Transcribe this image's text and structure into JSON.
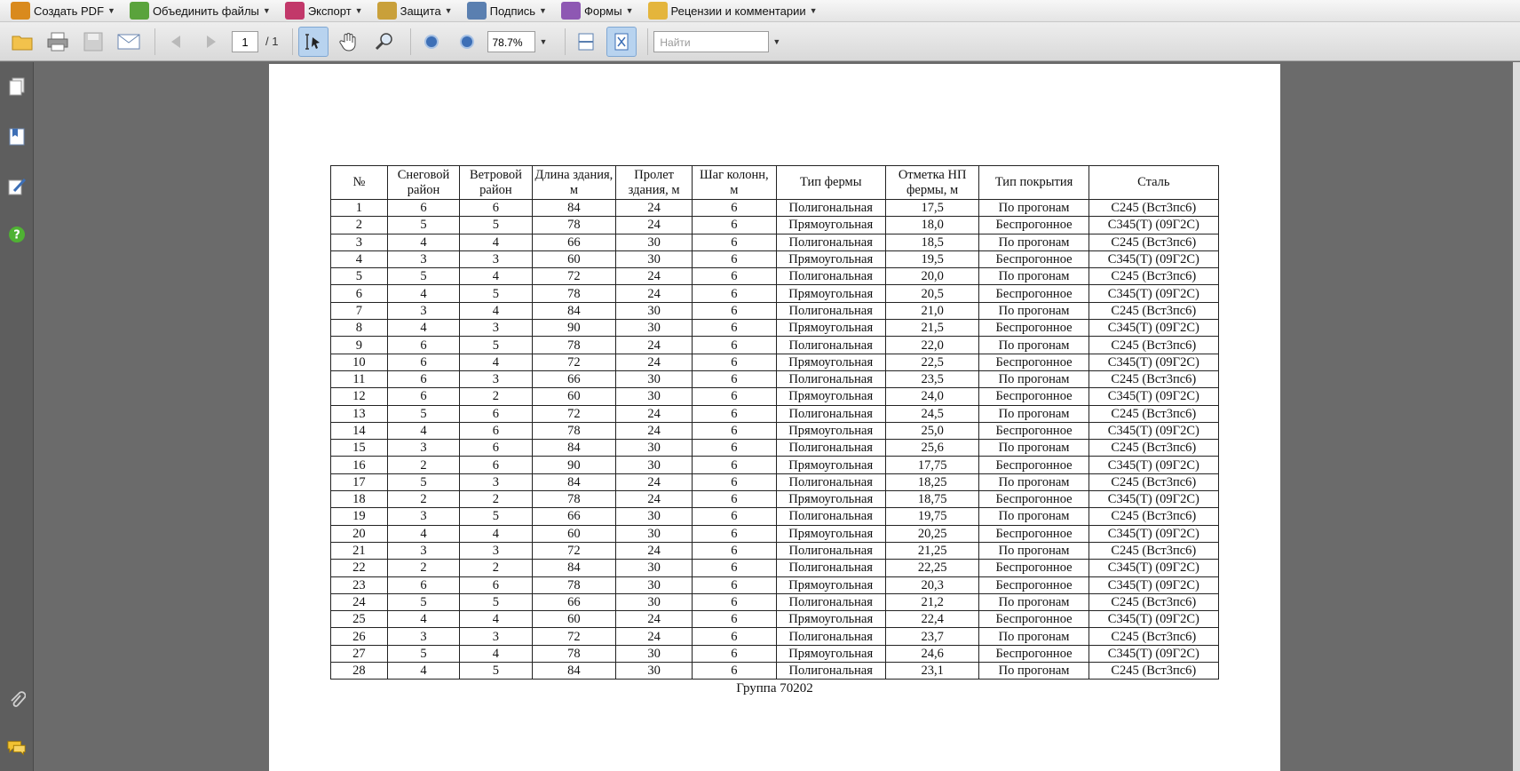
{
  "menubar": {
    "items": [
      {
        "label": "Создать PDF",
        "icon": "create-pdf-icon",
        "color": "#d98a1d"
      },
      {
        "label": "Объединить файлы",
        "icon": "combine-files-icon",
        "color": "#5aa33c"
      },
      {
        "label": "Экспорт",
        "icon": "export-icon",
        "color": "#c2386a"
      },
      {
        "label": "Защита",
        "icon": "lock-icon",
        "color": "#c9a03a"
      },
      {
        "label": "Подпись",
        "icon": "pen-icon",
        "color": "#5a7fb0"
      },
      {
        "label": "Формы",
        "icon": "form-icon",
        "color": "#8e58b3"
      },
      {
        "label": "Рецензии и комментарии",
        "icon": "comment-icon",
        "color": "#e4b53c"
      }
    ]
  },
  "toolbar": {
    "current_page": "1",
    "total_pages": "/ 1",
    "zoom": "78.7%",
    "search_placeholder": "Найти"
  },
  "table": {
    "headers": [
      "№",
      "Снеговой район",
      "Ветровой район",
      "Длина здания, м",
      "Пролет здания, м",
      "Шаг колонн, м",
      "Тип фермы",
      "Отметка НП фермы, м",
      "Тип покрытия",
      "Сталь"
    ],
    "rows": [
      [
        "1",
        "6",
        "6",
        "84",
        "24",
        "6",
        "Полигональная",
        "17,5",
        "По прогонам",
        "С245 (Вст3пс6)"
      ],
      [
        "2",
        "5",
        "5",
        "78",
        "24",
        "6",
        "Прямоугольная",
        "18,0",
        "Беспрогонное",
        "С345(Т) (09Г2С)"
      ],
      [
        "3",
        "4",
        "4",
        "66",
        "30",
        "6",
        "Полигональная",
        "18,5",
        "По прогонам",
        "С245 (Вст3пс6)"
      ],
      [
        "4",
        "3",
        "3",
        "60",
        "30",
        "6",
        "Прямоугольная",
        "19,5",
        "Беспрогонное",
        "С345(Т) (09Г2С)"
      ],
      [
        "5",
        "5",
        "4",
        "72",
        "24",
        "6",
        "Полигональная",
        "20,0",
        "По прогонам",
        "С245 (Вст3пс6)"
      ],
      [
        "6",
        "4",
        "5",
        "78",
        "24",
        "6",
        "Прямоугольная",
        "20,5",
        "Беспрогонное",
        "С345(Т) (09Г2С)"
      ],
      [
        "7",
        "3",
        "4",
        "84",
        "30",
        "6",
        "Полигональная",
        "21,0",
        "По прогонам",
        "С245 (Вст3пс6)"
      ],
      [
        "8",
        "4",
        "3",
        "90",
        "30",
        "6",
        "Прямоугольная",
        "21,5",
        "Беспрогонное",
        "С345(Т) (09Г2С)"
      ],
      [
        "9",
        "6",
        "5",
        "78",
        "24",
        "6",
        "Полигональная",
        "22,0",
        "По прогонам",
        "С245 (Вст3пс6)"
      ],
      [
        "10",
        "6",
        "4",
        "72",
        "24",
        "6",
        "Прямоугольная",
        "22,5",
        "Беспрогонное",
        "С345(Т) (09Г2С)"
      ],
      [
        "11",
        "6",
        "3",
        "66",
        "30",
        "6",
        "Полигональная",
        "23,5",
        "По прогонам",
        "С245 (Вст3пс6)"
      ],
      [
        "12",
        "6",
        "2",
        "60",
        "30",
        "6",
        "Прямоугольная",
        "24,0",
        "Беспрогонное",
        "С345(Т) (09Г2С)"
      ],
      [
        "13",
        "5",
        "6",
        "72",
        "24",
        "6",
        "Полигональная",
        "24,5",
        "По прогонам",
        "С245 (Вст3пс6)"
      ],
      [
        "14",
        "4",
        "6",
        "78",
        "24",
        "6",
        "Прямоугольная",
        "25,0",
        "Беспрогонное",
        "С345(Т) (09Г2С)"
      ],
      [
        "15",
        "3",
        "6",
        "84",
        "30",
        "6",
        "Полигональная",
        "25,6",
        "По прогонам",
        "С245 (Вст3пс6)"
      ],
      [
        "16",
        "2",
        "6",
        "90",
        "30",
        "6",
        "Прямоугольная",
        "17,75",
        "Беспрогонное",
        "С345(Т) (09Г2С)"
      ],
      [
        "17",
        "5",
        "3",
        "84",
        "24",
        "6",
        "Полигональная",
        "18,25",
        "По прогонам",
        "С245 (Вст3пс6)"
      ],
      [
        "18",
        "2",
        "2",
        "78",
        "24",
        "6",
        "Прямоугольная",
        "18,75",
        "Беспрогонное",
        "С345(Т) (09Г2С)"
      ],
      [
        "19",
        "3",
        "5",
        "66",
        "30",
        "6",
        "Полигональная",
        "19,75",
        "По прогонам",
        "С245 (Вст3пс6)"
      ],
      [
        "20",
        "4",
        "4",
        "60",
        "30",
        "6",
        "Прямоугольная",
        "20,25",
        "Беспрогонное",
        "С345(Т) (09Г2С)"
      ],
      [
        "21",
        "3",
        "3",
        "72",
        "24",
        "6",
        "Полигональная",
        "21,25",
        "По прогонам",
        "С245 (Вст3пс6)"
      ],
      [
        "22",
        "2",
        "2",
        "84",
        "30",
        "6",
        "Полигональная",
        "22,25",
        "Беспрогонное",
        "С345(Т) (09Г2С)"
      ],
      [
        "23",
        "6",
        "6",
        "78",
        "30",
        "6",
        "Прямоугольная",
        "20,3",
        "Беспрогонное",
        "С345(Т) (09Г2С)"
      ],
      [
        "24",
        "5",
        "5",
        "66",
        "30",
        "6",
        "Полигональная",
        "21,2",
        "По прогонам",
        "С245 (Вст3пс6)"
      ],
      [
        "25",
        "4",
        "4",
        "60",
        "24",
        "6",
        "Прямоугольная",
        "22,4",
        "Беспрогонное",
        "С345(Т) (09Г2С)"
      ],
      [
        "26",
        "3",
        "3",
        "72",
        "24",
        "6",
        "Полигональная",
        "23,7",
        "По прогонам",
        "С245 (Вст3пс6)"
      ],
      [
        "27",
        "5",
        "4",
        "78",
        "30",
        "6",
        "Прямоугольная",
        "24,6",
        "Беспрогонное",
        "С345(Т) (09Г2С)"
      ],
      [
        "28",
        "4",
        "5",
        "84",
        "30",
        "6",
        "Полигональная",
        "23,1",
        "По прогонам",
        "С245 (Вст3пс6)"
      ]
    ]
  },
  "caption": "Группа 70202"
}
